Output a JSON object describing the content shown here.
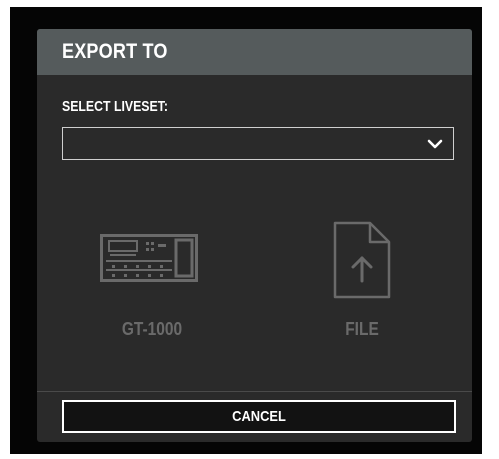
{
  "dialog": {
    "title": "EXPORT TO",
    "select_label": "SELECT LIVESET:",
    "select_value": "",
    "targets": [
      {
        "label": "GT-1000",
        "icon": "gt1000-device-icon"
      },
      {
        "label": "FILE",
        "icon": "file-upload-icon"
      }
    ],
    "cancel_label": "CANCEL"
  },
  "colors": {
    "header_bg": "#555b5c",
    "dialog_bg": "#2a2a2a",
    "backdrop": "#050505",
    "disabled_text": "#6a6a6a",
    "text": "#ffffff"
  }
}
